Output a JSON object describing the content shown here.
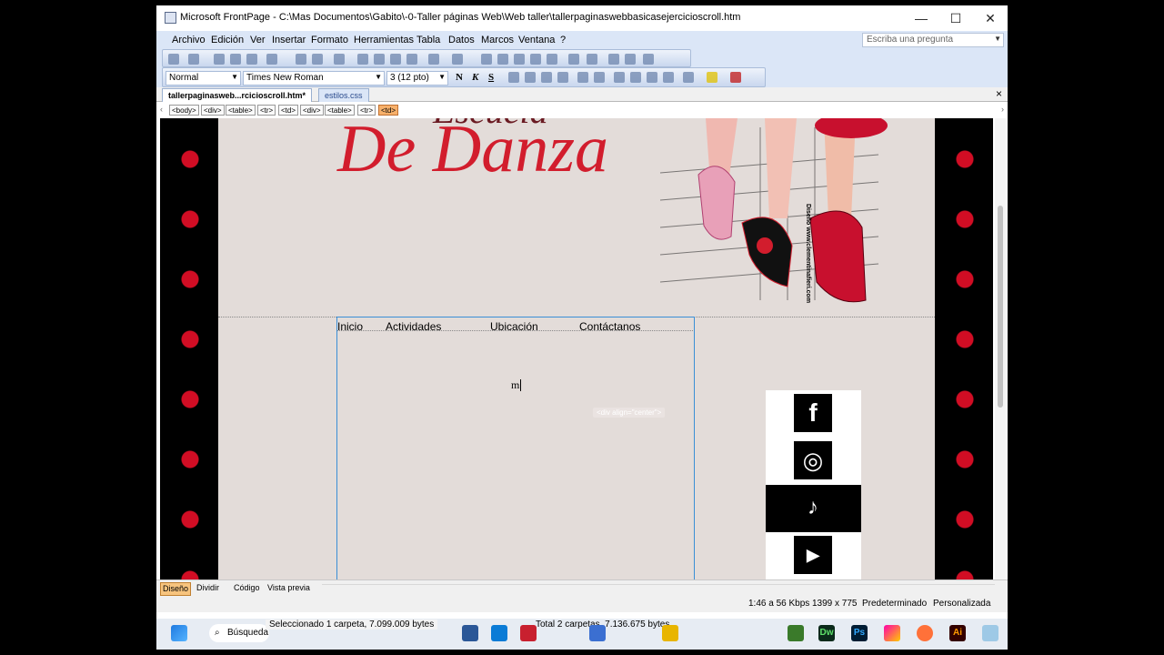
{
  "window": {
    "title": "Microsoft FrontPage - C:\\Mas Documentos\\Gabito\\-0-Taller páginas Web\\Web taller\\tallerpaginaswebbasicasejercicioscroll.htm",
    "minimize": "—",
    "maximize": "☐",
    "close": "✕"
  },
  "menu": {
    "items": [
      "Archivo",
      "Edición",
      "Ver",
      "Insertar",
      "Formato",
      "Herramientas",
      "Tabla",
      "Datos",
      "Marcos",
      "Ventana",
      "?"
    ],
    "ask_placeholder": "Escriba una pregunta"
  },
  "formatting": {
    "style": "Normal",
    "font": "Times New Roman",
    "size": "3  (12 pto)",
    "bold": "N",
    "italic": "K",
    "underline": "S"
  },
  "tabs": {
    "active": "tallerpaginasweb...rcicioscroll.htm*",
    "other": "estilos.css",
    "close": "×"
  },
  "tag_path": [
    "<body>",
    "<div>",
    "<table>",
    "<tr>",
    "<td>",
    "<div>",
    "<table>",
    "<tr>",
    "<td>"
  ],
  "page": {
    "brand_top": "Escuela",
    "brand_main": "De Danza",
    "credit": "Diseño www.clementinafieri.com",
    "nav": [
      "Inicio",
      "Actividades",
      "Ubicación",
      "Contáctanos"
    ],
    "cursor_text": "m",
    "div_hint": "<div align=\"center\">",
    "social": [
      {
        "name": "facebook-icon",
        "glyph": "f"
      },
      {
        "name": "instagram-icon",
        "glyph": "◎"
      },
      {
        "name": "tiktok-icon",
        "glyph": "♪"
      },
      {
        "name": "youtube-icon",
        "glyph": "▶"
      }
    ]
  },
  "view_tabs": [
    "Diseño",
    "Dividir",
    "Código",
    "Vista previa"
  ],
  "status": {
    "speed": "1:46 a 56 Kbps",
    "dimensions": "1399 x 775",
    "mode": "Predeterminado",
    "custom": "Personalizada"
  },
  "taskbar": {
    "search": "Búsqueda",
    "selection": "Seleccionado 1 carpeta, 7.099.009 bytes",
    "total": "Total 2 carpetas, 7.136.675 bytes",
    "app_labels": [
      "Dw",
      "Ps",
      "Ai"
    ]
  },
  "colors": {
    "accent_red": "#d21d2d",
    "menu_bg": "#dbe6f7",
    "page_bg": "#e3dcd9",
    "selection_blue": "#3a8fd6"
  }
}
